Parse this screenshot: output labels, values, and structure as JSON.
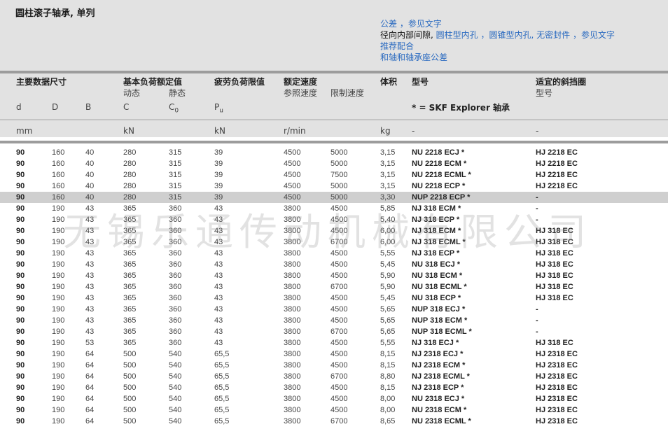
{
  "title": "圆柱滚子轴承, 单列",
  "links": {
    "tolerances": "公差 ，参见文字",
    "clearance_prefix": "径向内部间隙,",
    "cyl_bore": "圆柱型内孔",
    "taper_bore": "圆锥型内孔",
    "no_seal": "无密封件",
    "see_text": "参见文字",
    "sep": "，",
    "fits": "推荐配合",
    "housing_tol": "和轴和轴承座公差"
  },
  "header": {
    "main_dims": "主要数据尺寸",
    "load_ratings": "基本负荷额定值",
    "dynamic": "动态",
    "static": "静态",
    "fatigue": "疲劳负荷限值",
    "speed_ratings": "额定速度",
    "ref_speed": "参照速度",
    "limit_speed": "限制速度",
    "mass": "体积",
    "designation": "型号",
    "ring": "适宜的斜挡圈",
    "ring_designation": "型号",
    "col_d": "d",
    "col_D": "D",
    "col_B": "B",
    "col_C": "C",
    "col_C0": "C",
    "col_C0_sub": "0",
    "col_Pu": "P",
    "col_Pu_sub": "u",
    "explorer": "* = SKF Explorer 轴承",
    "unit_mm": "mm",
    "unit_kN1": "kN",
    "unit_kN2": "kN",
    "unit_rmin": "r/min",
    "unit_kg": "kg",
    "unit_dash1": "-",
    "unit_dash2": "-"
  },
  "rows": [
    [
      "90",
      "160",
      "40",
      "280",
      "315",
      "39",
      "4500",
      "5000",
      "3,15",
      "NU 2218 ECJ *",
      "HJ 2218 EC"
    ],
    [
      "90",
      "160",
      "40",
      "280",
      "315",
      "39",
      "4500",
      "5000",
      "3,15",
      "NU 2218 ECM *",
      "HJ 2218 EC"
    ],
    [
      "90",
      "160",
      "40",
      "280",
      "315",
      "39",
      "4500",
      "7500",
      "3,15",
      "NU 2218 ECML *",
      "HJ 2218 EC"
    ],
    [
      "90",
      "160",
      "40",
      "280",
      "315",
      "39",
      "4500",
      "5000",
      "3,15",
      "NU 2218 ECP *",
      "HJ 2218 EC"
    ],
    [
      "90",
      "160",
      "40",
      "280",
      "315",
      "39",
      "4500",
      "5000",
      "3,30",
      "NUP 2218 ECP *",
      "-"
    ],
    [
      "90",
      "190",
      "43",
      "365",
      "360",
      "43",
      "3800",
      "4500",
      "5,85",
      "NJ 318 ECM *",
      "-"
    ],
    [
      "90",
      "190",
      "43",
      "365",
      "360",
      "43",
      "3800",
      "4500",
      "5,40",
      "NJ 318 ECP *",
      "-"
    ],
    [
      "90",
      "190",
      "43",
      "365",
      "360",
      "43",
      "3800",
      "4500",
      "6,00",
      "NJ 318 ECM *",
      "HJ 318 EC"
    ],
    [
      "90",
      "190",
      "43",
      "365",
      "360",
      "43",
      "3800",
      "6700",
      "6,00",
      "NJ 318 ECML *",
      "HJ 318 EC"
    ],
    [
      "90",
      "190",
      "43",
      "365",
      "360",
      "43",
      "3800",
      "4500",
      "5,55",
      "NJ 318 ECP *",
      "HJ 318 EC"
    ],
    [
      "90",
      "190",
      "43",
      "365",
      "360",
      "43",
      "3800",
      "4500",
      "5,45",
      "NU 318 ECJ *",
      "HJ 318 EC"
    ],
    [
      "90",
      "190",
      "43",
      "365",
      "360",
      "43",
      "3800",
      "4500",
      "5,90",
      "NU 318 ECM *",
      "HJ 318 EC"
    ],
    [
      "90",
      "190",
      "43",
      "365",
      "360",
      "43",
      "3800",
      "6700",
      "5,90",
      "NU 318 ECML *",
      "HJ 318 EC"
    ],
    [
      "90",
      "190",
      "43",
      "365",
      "360",
      "43",
      "3800",
      "4500",
      "5,45",
      "NU 318 ECP *",
      "HJ 318 EC"
    ],
    [
      "90",
      "190",
      "43",
      "365",
      "360",
      "43",
      "3800",
      "4500",
      "5,65",
      "NUP 318 ECJ *",
      "-"
    ],
    [
      "90",
      "190",
      "43",
      "365",
      "360",
      "43",
      "3800",
      "4500",
      "5,65",
      "NUP 318 ECM *",
      "-"
    ],
    [
      "90",
      "190",
      "43",
      "365",
      "360",
      "43",
      "3800",
      "6700",
      "5,65",
      "NUP 318 ECML *",
      "-"
    ],
    [
      "90",
      "190",
      "53",
      "365",
      "360",
      "43",
      "3800",
      "4500",
      "5,55",
      "NJ 318 ECJ *",
      "HJ 318 EC"
    ],
    [
      "90",
      "190",
      "64",
      "500",
      "540",
      "65,5",
      "3800",
      "4500",
      "8,15",
      "NJ 2318 ECJ *",
      "HJ 2318 EC"
    ],
    [
      "90",
      "190",
      "64",
      "500",
      "540",
      "65,5",
      "3800",
      "4500",
      "8,15",
      "NJ 2318 ECM *",
      "HJ 2318 EC"
    ],
    [
      "90",
      "190",
      "64",
      "500",
      "540",
      "65,5",
      "3800",
      "6700",
      "8,80",
      "NJ 2318 ECML *",
      "HJ 2318 EC"
    ],
    [
      "90",
      "190",
      "64",
      "500",
      "540",
      "65,5",
      "3800",
      "4500",
      "8,15",
      "NJ 2318 ECP *",
      "HJ 2318 EC"
    ],
    [
      "90",
      "190",
      "64",
      "500",
      "540",
      "65,5",
      "3800",
      "4500",
      "8,00",
      "NU 2318 ECJ *",
      "HJ 2318 EC"
    ],
    [
      "90",
      "190",
      "64",
      "500",
      "540",
      "65,5",
      "3800",
      "4500",
      "8,00",
      "NU 2318 ECM *",
      "HJ 2318 EC"
    ],
    [
      "90",
      "190",
      "64",
      "500",
      "540",
      "65,5",
      "3800",
      "6700",
      "8,65",
      "NU 2318 ECML *",
      "HJ 2318 EC"
    ]
  ],
  "highlight_row": 4,
  "watermark": "无锡乐通传动机械有限公司"
}
